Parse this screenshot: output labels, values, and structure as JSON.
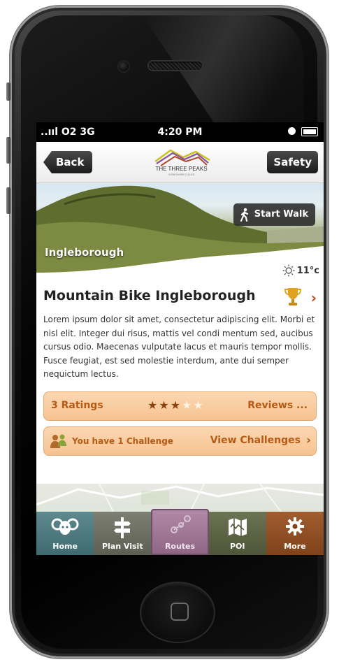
{
  "statusbar": {
    "carrier": "..ııl O2  3G",
    "time": "4:20 PM"
  },
  "navbar": {
    "back_label": "Back",
    "safety_label": "Safety",
    "logo_text": "THE THREE PEAKS",
    "logo_subtext": "YORKSHIRE DALES"
  },
  "hero": {
    "location": "Ingleborough",
    "start_walk_label": "Start Walk",
    "weather_temp": "11°c"
  },
  "walk": {
    "title": "Mountain Bike Ingleborough",
    "description": "Lorem ipsum dolor sit amet, consectetur adipiscing elit. Morbi et nisl elit. Integer dui risus, mattis vel condi mentum sed, aucibus cursus odio. Maecenas vulputate lacus et mauris tempor mollis. Fusce feugiat, est sed molestie interdum, ante dui semper nequictum lectus."
  },
  "ratings": {
    "count_label": "3 Ratings",
    "stars_filled": 3,
    "stars_total": 5,
    "reviews_label": "Reviews ..."
  },
  "challenge": {
    "text": "You have 1 Challenge",
    "view_label": "View Challenges"
  },
  "tabs": [
    {
      "label": "Home",
      "icon": "ram-icon"
    },
    {
      "label": "Plan Visit",
      "icon": "signpost-icon"
    },
    {
      "label": "Routes",
      "icon": "route-icon"
    },
    {
      "label": "POI",
      "icon": "map-icon"
    },
    {
      "label": "More",
      "icon": "gear-icon"
    }
  ],
  "colors": {
    "accent_orange": "#c0451b",
    "bar_fill": "#f6c391",
    "bar_text": "#b75a14"
  }
}
